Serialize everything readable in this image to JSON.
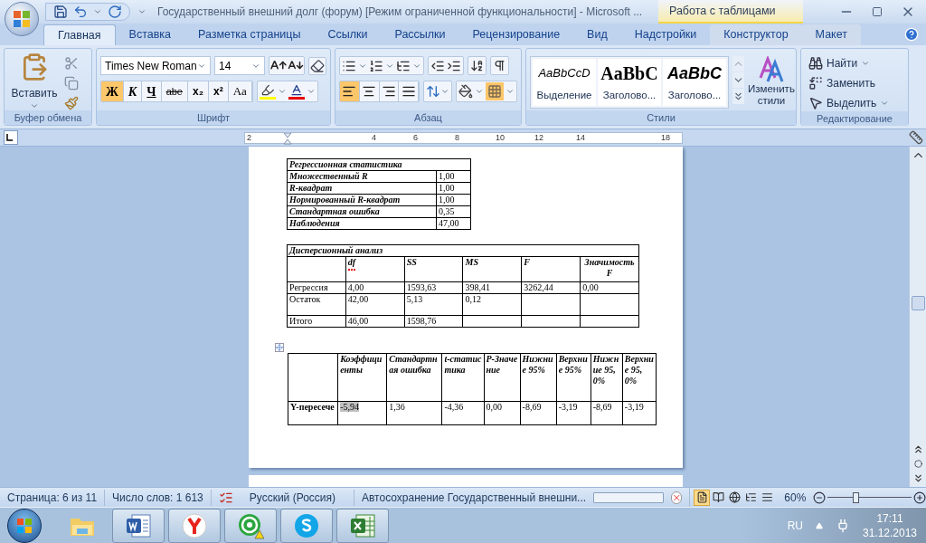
{
  "title_bar": {
    "title": "Государственный внешний долг (форум) [Режим ограниченной функциональности] - Microsoft ...",
    "contextual_group": "Работа с таблицами"
  },
  "tabs": [
    {
      "label": "Главная",
      "selected": true,
      "contextual": false
    },
    {
      "label": "Вставка",
      "selected": false,
      "contextual": false
    },
    {
      "label": "Разметка страницы",
      "selected": false,
      "contextual": false
    },
    {
      "label": "Ссылки",
      "selected": false,
      "contextual": false
    },
    {
      "label": "Рассылки",
      "selected": false,
      "contextual": false
    },
    {
      "label": "Рецензирование",
      "selected": false,
      "contextual": false
    },
    {
      "label": "Вид",
      "selected": false,
      "contextual": false
    },
    {
      "label": "Надстройки",
      "selected": false,
      "contextual": false
    },
    {
      "label": "Конструктор",
      "selected": false,
      "contextual": true
    },
    {
      "label": "Макет",
      "selected": false,
      "contextual": true
    }
  ],
  "clipboard": {
    "label": "Буфер обмена",
    "paste": "Вставить"
  },
  "font": {
    "label": "Шрифт",
    "name": "Times New Roman",
    "size": "14",
    "format_buttons": [
      {
        "kind": "bold",
        "label": "Ж",
        "selected": true
      },
      {
        "kind": "italic",
        "label": "К",
        "selected": false
      },
      {
        "kind": "underline",
        "label": "Ч",
        "selected": false
      },
      {
        "kind": "strike",
        "label": "abe",
        "selected": false
      },
      {
        "kind": "sub",
        "label": "x₂",
        "selected": false
      },
      {
        "kind": "sup",
        "label": "x²",
        "selected": false
      },
      {
        "kind": "case",
        "label": "Aa",
        "selected": false
      }
    ]
  },
  "paragraph": {
    "label": "Абзац",
    "align_buttons": [
      {
        "kind": "left",
        "selected": true
      },
      {
        "kind": "center",
        "selected": false
      },
      {
        "kind": "right",
        "selected": false
      },
      {
        "kind": "justify",
        "selected": false
      }
    ],
    "borders_selected": true
  },
  "styles": {
    "label": "Стили",
    "gallery": [
      {
        "kind": "emphasis",
        "preview": "AaBbCcD",
        "label": "Выделение"
      },
      {
        "kind": "heading",
        "preview": "AaBbC",
        "label": "Заголово..."
      },
      {
        "kind": "heading_italic",
        "preview": "AaBbC",
        "label": "Заголово..."
      }
    ],
    "change": "Изменить стили"
  },
  "editing": {
    "label": "Редактирование",
    "items": [
      {
        "kind": "find",
        "label": "Найти",
        "dropdown": true
      },
      {
        "kind": "replace",
        "label": "Заменить",
        "dropdown": false
      },
      {
        "kind": "select",
        "label": "Выделить",
        "dropdown": true
      }
    ]
  },
  "ruler": {
    "labels": [
      "2",
      "4",
      "6",
      "8",
      "10",
      "12",
      "14",
      "18"
    ]
  },
  "regression_stats": {
    "title": "Регрессионная статистика",
    "rows": [
      {
        "name": "Множественный R",
        "value": "1,00"
      },
      {
        "name": "R-квадрат",
        "value": "1,00"
      },
      {
        "name": "Нормированный R-квадрат",
        "value": "1,00"
      },
      {
        "name": "Стандартная ошибка",
        "value": "0,35"
      },
      {
        "name": "Наблюдения",
        "value": "47,00"
      }
    ]
  },
  "anova": {
    "title": "Дисперсионный анализ",
    "columns": [
      {
        "label": "df",
        "misspelled": true
      },
      {
        "label": "SS",
        "misspelled": false
      },
      {
        "label": "MS",
        "misspelled": false
      },
      {
        "label": "F",
        "misspelled": false
      },
      {
        "label": "Значимость F",
        "misspelled": false
      }
    ],
    "rows": [
      {
        "name": "Регрессия",
        "cells": [
          "4,00",
          "1593,63",
          "398,41",
          "3262,44",
          "0,00"
        ]
      },
      {
        "name": "Остаток",
        "cells": [
          "42,00",
          "5,13",
          "0,12"
        ]
      },
      {
        "name": "Итого",
        "cells": [
          "46,00",
          "1598,76"
        ]
      }
    ]
  },
  "coefficients": {
    "columns": [
      "Коэффициенты",
      "Стандартная ошибка",
      "t-статистика",
      "P-Значение",
      "Нижние 95%",
      "Верхние 95%",
      "Нижние 95,0%",
      "Верхние 95,0%"
    ],
    "rows": [
      {
        "name": "Y-пересече",
        "cells": [
          {
            "text": "-5,94",
            "selected": true
          },
          {
            "text": "1,36",
            "selected": false
          },
          {
            "text": "-4,36",
            "selected": false
          },
          {
            "text": "0,00",
            "selected": false
          },
          {
            "text": "-8,69",
            "selected": false
          },
          {
            "text": "-3,19",
            "selected": false
          },
          {
            "text": "-8,69",
            "selected": false
          },
          {
            "text": "-3,19",
            "selected": false
          }
        ]
      }
    ]
  },
  "status_bar": {
    "page": "Страница: 6 из 11",
    "words": "Число слов: 1 613",
    "language": "Русский (Россия)",
    "autosave": "Автосохранение Государственный внешни...",
    "views": [
      {
        "kind": "print",
        "selected": true
      },
      {
        "kind": "reading",
        "selected": false
      },
      {
        "kind": "web",
        "selected": false
      },
      {
        "kind": "outline",
        "selected": false
      },
      {
        "kind": "draft",
        "selected": false
      }
    ],
    "autosave_progress": {
      "level": 0
    },
    "zoom": "60%",
    "zoom_slider": {
      "level": 0.33
    }
  },
  "taskbar": {
    "apps": [
      {
        "kind": "folder",
        "running": false
      },
      {
        "kind": "word",
        "running": true
      },
      {
        "kind": "browser",
        "running": true
      },
      {
        "kind": "agent",
        "running": true
      },
      {
        "kind": "skype",
        "running": true
      },
      {
        "kind": "excel",
        "running": true
      }
    ],
    "language": "RU",
    "time": "17:11",
    "date": "31.12.2013"
  }
}
